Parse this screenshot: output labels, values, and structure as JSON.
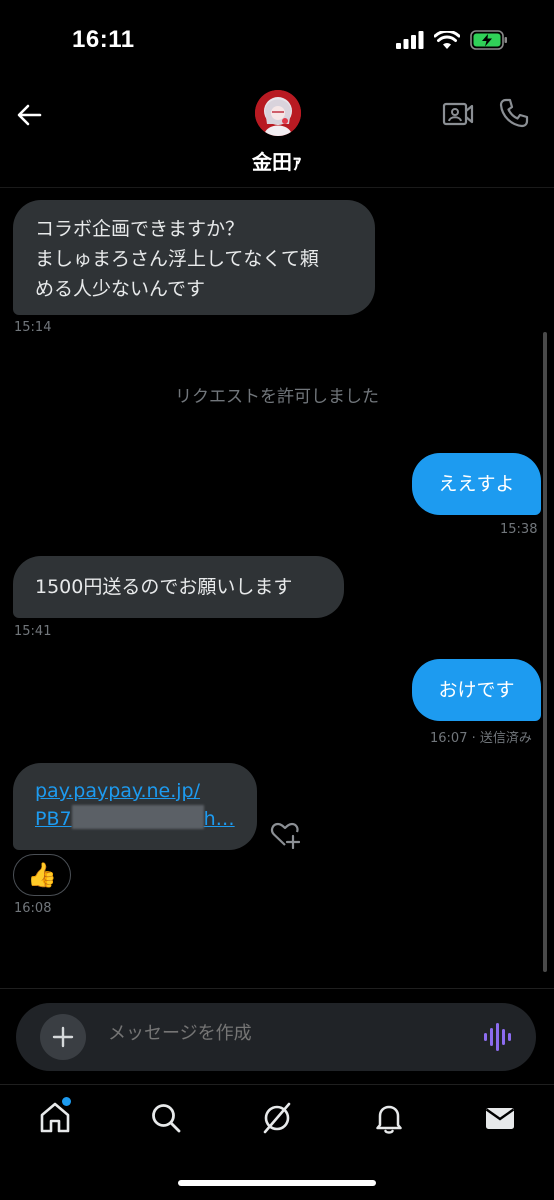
{
  "status_bar": {
    "time": "16:11"
  },
  "header": {
    "contact_name": "金田ｧ",
    "icons": [
      "back-arrow-icon",
      "video-call-icon",
      "phone-icon"
    ]
  },
  "messages": {
    "m1": {
      "lines": [
        "コラボ企画できますか？",
        "ましゅまろさん浮上してなくて頼",
        "める人少ないんです"
      ],
      "time": "15:14"
    },
    "system": "リクエストを許可しました",
    "m2": {
      "text": "ええすよ",
      "time": "15:38"
    },
    "m3": {
      "text": "1500円送るのでお願いします",
      "time": "15:41"
    },
    "m4": {
      "text": "おけです",
      "status": "16:07 · 送信済み"
    },
    "m5": {
      "link_line1": "pay.paypay.ne.jp/",
      "link_prefix": "PB7",
      "link_suffix": "h…",
      "time": "16:08",
      "reaction": "👍"
    }
  },
  "compose": {
    "placeholder": "メッセージを作成"
  },
  "tab_bar": {
    "items": [
      "home-icon",
      "search-icon",
      "grok-icon",
      "notifications-icon",
      "messages-icon"
    ]
  },
  "colors": {
    "accent": "#1d9bf0",
    "incoming_bubble": "#2f3336",
    "voice_icon": "#8c6cf0"
  }
}
